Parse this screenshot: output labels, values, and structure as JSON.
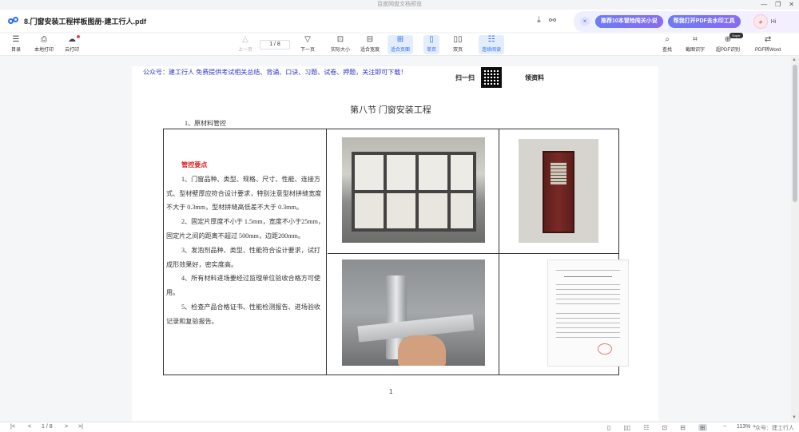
{
  "window": {
    "title": "百度网盘文档预览",
    "controls": [
      "—",
      "❐",
      "✕"
    ]
  },
  "file": {
    "name": "8.门窗安装工程样板图册-建工行人.pdf",
    "icons": [
      "download-icon",
      "share-icon"
    ]
  },
  "promo": {
    "close_symbol": "×",
    "btn1": "推荐10本冒险闯关小说",
    "btn2": "帮我打开PDF去水印工具",
    "avatar_symbol": "◕",
    "hi": "Hi"
  },
  "toolbar": {
    "left": [
      {
        "label": "目录",
        "icon": "☰"
      },
      {
        "label": "本地打印",
        "icon": "⎙"
      },
      {
        "label": "云打印",
        "icon": "☁"
      }
    ],
    "nav": {
      "prev": {
        "label": "上一页",
        "icon": "△"
      },
      "page": "1 / 8",
      "next": {
        "label": "下一页",
        "icon": "▽"
      }
    },
    "views": [
      {
        "label": "实际大小",
        "icon": "⊡"
      },
      {
        "label": "适合宽度",
        "icon": "⊟"
      },
      {
        "label": "适合页面",
        "icon": "⊞"
      },
      {
        "label": "单页",
        "icon": "▯"
      },
      {
        "label": "双页",
        "icon": "▯▯"
      },
      {
        "label": "连续阅读",
        "icon": "☷"
      }
    ],
    "right": [
      {
        "label": "查找",
        "icon": "⌕"
      },
      {
        "label": "截图识字",
        "icon": "⌗"
      },
      {
        "label": "超PDF识别",
        "icon": "⊕"
      },
      {
        "label": "PDF转Word",
        "icon": "⇄"
      }
    ],
    "pdf_badge": "Super"
  },
  "document": {
    "header_text": "公众号：建工行人 免费提供考试相关总结、背诵、口诀、习题、试卷、押题，关注即可下载！",
    "qr_left": "扫一扫",
    "qr_right": "领资料",
    "section_title": "第八节 门窗安装工程",
    "subhead": "1、原材料管控",
    "control_title": "管控要点",
    "points": [
      "1、门窗品种、类型、规格、尺寸、性能、连接方式、型材壁厚应符合设计要求，特别注意型材拼缝宽度不大于 0.3mm，型材拼缝高低差不大于 0.3mm。",
      "2、固定片厚度不小于 1.5mm，宽度不小于25mm，固定片之间的距离不超过 500mm，边距200mm。",
      "3、发泡剂品种、类型、性能符合设计要求，试打成形效果好，密实度高。",
      "4、所有材料进场要经过监理单位验收合格方可使用。",
      "5、检查产品合格证书、性能检测报告、进场验收记录和复验报告。"
    ],
    "page_number": "1"
  },
  "statusbar": {
    "first": "|<",
    "prev": "<",
    "page": "1 / 8",
    "next": ">",
    "last": ">|",
    "zoom_out": "−",
    "zoom": "113%",
    "zoom_in": "+",
    "watermark": "众号：建工行人"
  },
  "status_icons": [
    "▯",
    "▯▯",
    "☷",
    "⊡",
    "⊟",
    "⊞"
  ]
}
